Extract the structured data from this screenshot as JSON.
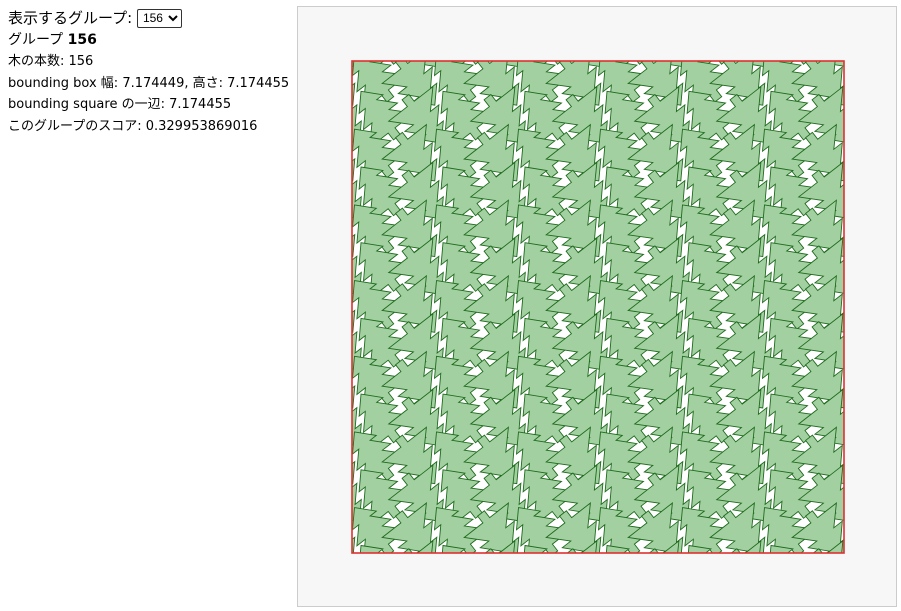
{
  "controls": {
    "select_label": "表示するグループ:",
    "selected_group": "156",
    "options": [
      "156"
    ]
  },
  "info": {
    "group_label": "グループ",
    "group_number": "156",
    "tree_count": "木の本数: 156",
    "bbox": "bounding box 幅: 7.174449, 高さ: 7.174455",
    "square_side": "bounding square の一辺: 7.174455",
    "score": "このグループのスコア: 0.329953869016"
  },
  "plot": {
    "tree_fill": "#a3d0a0",
    "tree_stroke": "#1e6b1e",
    "bound_stroke": "#e03030",
    "background": "#f7f7f7",
    "columns": 6,
    "rows": 13,
    "trees_per_cell": 2
  }
}
